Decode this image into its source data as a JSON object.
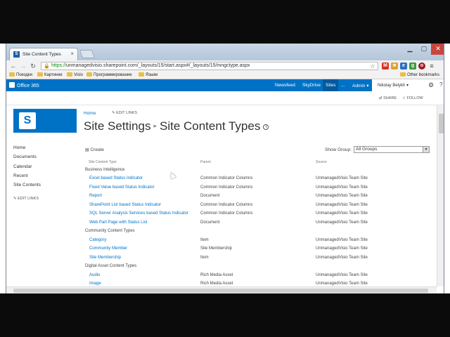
{
  "browser": {
    "tab_title": "Site Content Types",
    "favicon": "S",
    "close_glyph": "×",
    "url_secure": "https://",
    "url_rest": "unmanagedvisio.sharepoint.com/_layouts/15/start.aspx#/_layouts/15/mngctype.aspx",
    "bookmarks": [
      "Поездки",
      "Картинки",
      "Visio",
      "Программирование",
      "Языки"
    ],
    "other_bookmarks": "Other bookmarks"
  },
  "o365": {
    "brand": "Office 365",
    "nav": [
      "Newsfeed",
      "SkyDrive",
      "Sites",
      "...",
      "Admin ▾"
    ],
    "active_nav": "Sites",
    "user": "Nikolay Belykh ▾",
    "share": "SHARE",
    "follow": "FOLLOW"
  },
  "page": {
    "breadcrumb_home": "Home",
    "edit_links_top": "EDIT LINKS",
    "title_part1": "Site Settings",
    "title_sep": "▸",
    "title_part2": "Site Content Types",
    "info_icon": "i"
  },
  "leftnav": {
    "items": [
      "Home",
      "Documents",
      "Calendar",
      "Recent",
      "Site Contents"
    ],
    "edit_links": "EDIT LINKS"
  },
  "toolbar": {
    "create": "Create",
    "show_group_label": "Show Group:",
    "show_group_value": "All Groups"
  },
  "table": {
    "headers": [
      "Site Content Type",
      "Parent",
      "Source"
    ],
    "groups": [
      {
        "name": "Business Intelligence",
        "rows": [
          {
            "name": "Excel based Status Indicator",
            "parent": "Common Indicator Columns",
            "source": "UnmanagedVisio Team Site"
          },
          {
            "name": "Fixed Value based Status Indicator",
            "parent": "Common Indicator Columns",
            "source": "UnmanagedVisio Team Site"
          },
          {
            "name": "Report",
            "parent": "Document",
            "source": "UnmanagedVisio Team Site"
          },
          {
            "name": "SharePoint List based Status Indicator",
            "parent": "Common Indicator Columns",
            "source": "UnmanagedVisio Team Site"
          },
          {
            "name": "SQL Server Analysis Services based Status Indicator",
            "parent": "Common Indicator Columns",
            "source": "UnmanagedVisio Team Site"
          },
          {
            "name": "Web Part Page with Status List",
            "parent": "Document",
            "source": "UnmanagedVisio Team Site"
          }
        ]
      },
      {
        "name": "Community Content Types",
        "rows": [
          {
            "name": "Category",
            "parent": "Item",
            "source": "UnmanagedVisio Team Site"
          },
          {
            "name": "Community Member",
            "parent": "Site Membership",
            "source": "UnmanagedVisio Team Site"
          },
          {
            "name": "Site Membership",
            "parent": "Item",
            "source": "UnmanagedVisio Team Site"
          }
        ]
      },
      {
        "name": "Digital Asset Content Types",
        "rows": [
          {
            "name": "Audio",
            "parent": "Rich Media Asset",
            "source": "UnmanagedVisio Team Site"
          },
          {
            "name": "Image",
            "parent": "Rich Media Asset",
            "source": "UnmanagedVisio Team Site"
          }
        ]
      }
    ]
  },
  "colors": {
    "o365_blue": "#0072c6",
    "link": "#0072c6",
    "text": "#444444"
  }
}
